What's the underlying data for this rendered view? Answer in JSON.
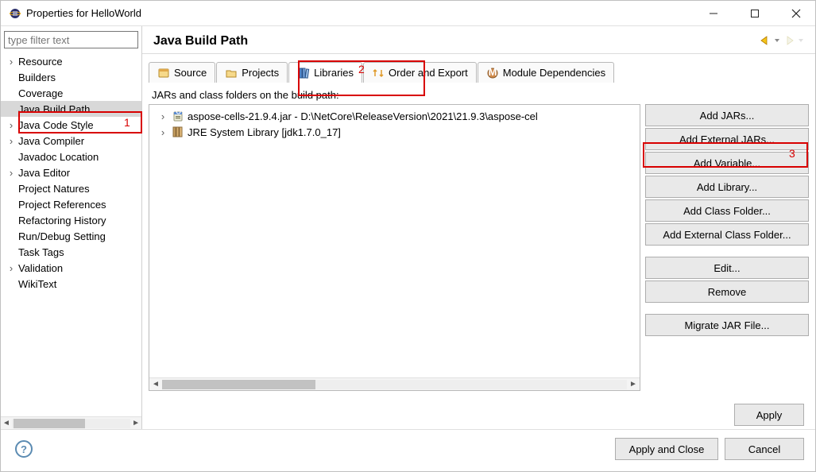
{
  "window": {
    "title": "Properties for HelloWorld"
  },
  "filter": {
    "placeholder": "type filter text"
  },
  "sidebar": {
    "items": [
      {
        "label": "Resource",
        "hasChildren": true,
        "selected": false
      },
      {
        "label": "Builders",
        "hasChildren": false,
        "selected": false
      },
      {
        "label": "Coverage",
        "hasChildren": false,
        "selected": false
      },
      {
        "label": "Java Build Path",
        "hasChildren": false,
        "selected": true
      },
      {
        "label": "Java Code Style",
        "hasChildren": true,
        "selected": false
      },
      {
        "label": "Java Compiler",
        "hasChildren": true,
        "selected": false
      },
      {
        "label": "Javadoc Location",
        "hasChildren": false,
        "selected": false
      },
      {
        "label": "Java Editor",
        "hasChildren": true,
        "selected": false
      },
      {
        "label": "Project Natures",
        "hasChildren": false,
        "selected": false
      },
      {
        "label": "Project References",
        "hasChildren": false,
        "selected": false
      },
      {
        "label": "Refactoring History",
        "hasChildren": false,
        "selected": false
      },
      {
        "label": "Run/Debug Setting",
        "hasChildren": false,
        "selected": false
      },
      {
        "label": "Task Tags",
        "hasChildren": false,
        "selected": false
      },
      {
        "label": "Validation",
        "hasChildren": true,
        "selected": false
      },
      {
        "label": "WikiText",
        "hasChildren": false,
        "selected": false
      }
    ]
  },
  "page": {
    "heading": "Java Build Path"
  },
  "tabs": [
    {
      "id": "source",
      "label": "Source",
      "icon": "source-icon",
      "active": false
    },
    {
      "id": "projects",
      "label": "Projects",
      "icon": "projects-icon",
      "active": false
    },
    {
      "id": "libraries",
      "label": "Libraries",
      "icon": "libraries-icon",
      "active": true
    },
    {
      "id": "order",
      "label": "Order and Export",
      "icon": "order-icon",
      "active": false
    },
    {
      "id": "module",
      "label": "Module Dependencies",
      "icon": "module-icon",
      "active": false
    }
  ],
  "libraries": {
    "description": "JARs and class folders on the build path:",
    "entries": [
      {
        "icon": "jar-icon",
        "label": "aspose-cells-21.9.4.jar - D:\\NetCore\\ReleaseVersion\\2021\\21.9.3\\aspose-cel"
      },
      {
        "icon": "jre-icon",
        "label": "JRE System Library [jdk1.7.0_17]"
      }
    ]
  },
  "buttons": {
    "addJars": "Add JARs...",
    "addExternalJars": "Add External JARs...",
    "addVariable": "Add Variable...",
    "addLibrary": "Add Library...",
    "addClassFolder": "Add Class Folder...",
    "addExternalClassFolder": "Add External Class Folder...",
    "edit": "Edit...",
    "remove": "Remove",
    "migrateJar": "Migrate JAR File..."
  },
  "footer": {
    "apply": "Apply",
    "applyAndClose": "Apply and Close",
    "cancel": "Cancel"
  },
  "annotations": {
    "n1": "1",
    "n2": "2",
    "n3": "3"
  }
}
